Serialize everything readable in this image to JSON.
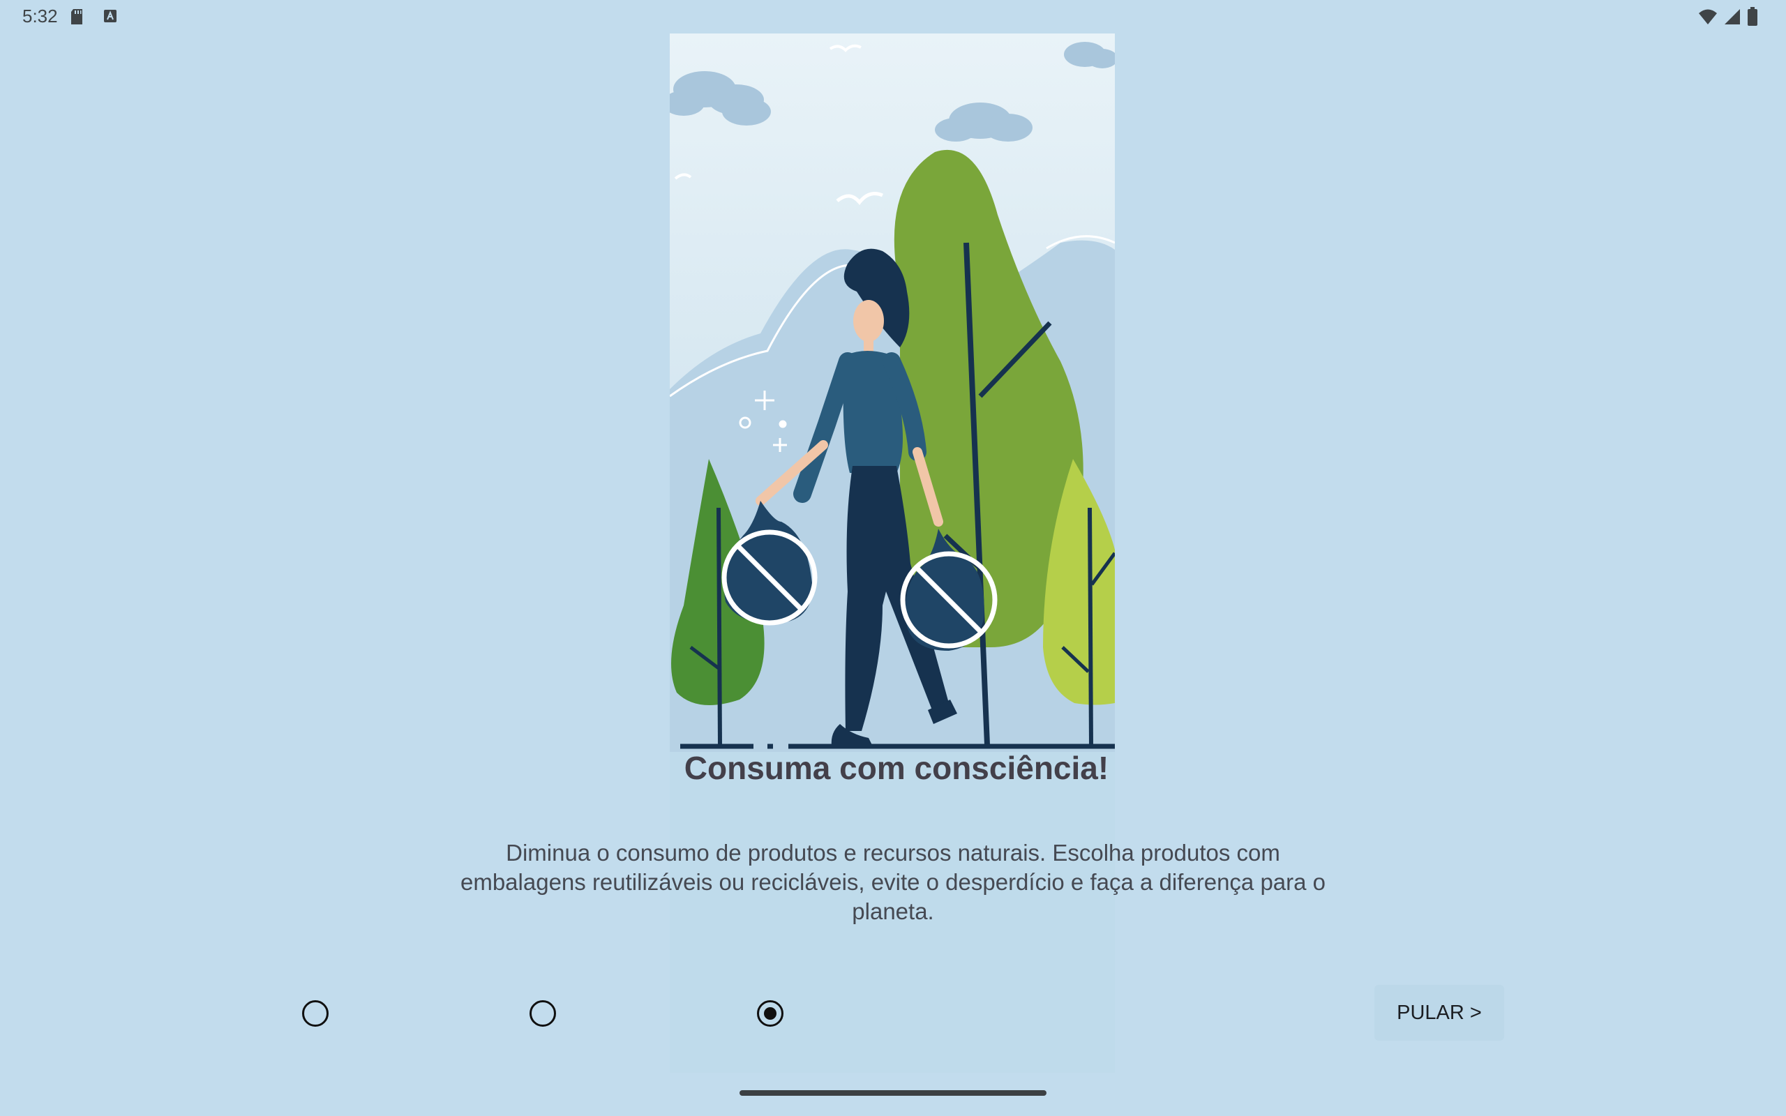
{
  "status_bar": {
    "time": "5:32",
    "left_icons": [
      "sd-card-icon",
      "keyboard-a-icon"
    ],
    "right_icons": [
      "wifi-icon",
      "cell-signal-icon",
      "battery-icon"
    ]
  },
  "onboarding": {
    "illustration": "woman-with-crossed-out-plastic-bags",
    "title": "Consuma com consciência!",
    "description": "Diminua o consumo de produtos e recursos naturais. Escolha produtos com embalagens reutilizáveis ou recicláveis, evite o desperdício e faça a diferença para o planeta.",
    "page_indicator": {
      "total": 3,
      "current": 3
    },
    "skip_label": "PULAR >"
  },
  "colors": {
    "background": "#c2dced",
    "title": "#43404a",
    "text": "#454952",
    "tree_green": "#7aa63a",
    "navy": "#1d3a5c"
  }
}
